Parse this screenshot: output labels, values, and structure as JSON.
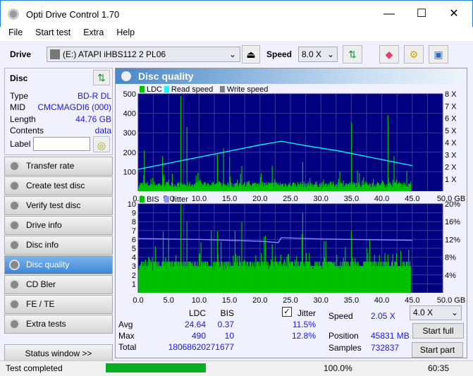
{
  "window": {
    "title": "Opti Drive Control 1.70",
    "minimize": "—",
    "maximize": "☐",
    "close": "✕"
  },
  "menu": [
    "File",
    "Start test",
    "Extra",
    "Help"
  ],
  "toolbar": {
    "drive_label": "Drive",
    "drive_value": "(E:)   ATAPI iHBS112   2 PL06",
    "speed_label": "Speed",
    "speed_value": "8.0 X"
  },
  "disc": {
    "title": "Disc",
    "rows": [
      {
        "k": "Type",
        "v": "BD-R DL"
      },
      {
        "k": "MID",
        "v": "CMCMAGDI6 (000)"
      },
      {
        "k": "Length",
        "v": "44.76 GB"
      },
      {
        "k": "Contents",
        "v": "data"
      }
    ],
    "label_label": "Label",
    "label_value": ""
  },
  "nav": [
    "Transfer rate",
    "Create test disc",
    "Verify test disc",
    "Drive info",
    "Disc info",
    "Disc quality",
    "CD Bler",
    "FE / TE",
    "Extra tests"
  ],
  "nav_active": "Disc quality",
  "status_window": "Status window >>",
  "panel_title": "Disc quality",
  "colors": {
    "ldc": "#00c000",
    "read_speed": "#00ffff",
    "write_speed": "#808080",
    "bis": "#00c000",
    "jitter": "#9090ff",
    "plot_bg": "#000080",
    "progress": "#06b025"
  },
  "chart_data": [
    {
      "type": "bar",
      "legend": [
        "LDC",
        "Read speed",
        "Write speed"
      ],
      "x_ticks": [
        "0.0",
        "5.0",
        "10.0",
        "15.0",
        "20.0",
        "25.0",
        "30.0",
        "35.0",
        "40.0",
        "45.0",
        "50.0 GB"
      ],
      "xlim": [
        0,
        50
      ],
      "y_ticks": [
        "100",
        "200",
        "300",
        "400",
        "500"
      ],
      "ylim": [
        0,
        500
      ],
      "y2_ticks": [
        "1 X",
        "2 X",
        "3 X",
        "4 X",
        "5 X",
        "6 X",
        "7 X",
        "8 X"
      ],
      "y2lim": [
        0,
        8
      ],
      "ldc_spikes": [
        [
          1,
          210
        ],
        [
          4,
          180
        ],
        [
          7,
          490
        ],
        [
          8,
          330
        ],
        [
          13,
          190
        ],
        [
          14,
          220
        ],
        [
          15,
          175
        ],
        [
          17,
          130
        ],
        [
          22,
          130
        ],
        [
          27,
          150
        ],
        [
          35,
          355
        ],
        [
          41,
          390
        ],
        [
          42,
          180
        ]
      ],
      "read_speed": [
        [
          0,
          1.8
        ],
        [
          5,
          2.3
        ],
        [
          10,
          2.8
        ],
        [
          15,
          3.3
        ],
        [
          20,
          3.8
        ],
        [
          23.5,
          4.1
        ],
        [
          28,
          3.7
        ],
        [
          33,
          3.3
        ],
        [
          38,
          2.8
        ],
        [
          42,
          2.4
        ],
        [
          45,
          2.1
        ]
      ]
    },
    {
      "type": "bar",
      "legend": [
        "BIS",
        "Jitter"
      ],
      "x_ticks": [
        "0.0",
        "5.0",
        "10.0",
        "15.0",
        "20.0",
        "25.0",
        "30.0",
        "35.0",
        "40.0",
        "45.0",
        "50.0 GB"
      ],
      "xlim": [
        0,
        50
      ],
      "y_ticks": [
        "1",
        "2",
        "3",
        "4",
        "5",
        "6",
        "7",
        "8",
        "9",
        "10"
      ],
      "ylim": [
        0,
        10
      ],
      "y2_ticks": [
        "4%",
        "8%",
        "12%",
        "16%",
        "20%"
      ],
      "y2lim": [
        0,
        20
      ],
      "bis_spikes": [
        [
          7,
          10
        ],
        [
          8,
          8
        ],
        [
          12,
          7
        ],
        [
          17,
          8
        ],
        [
          22,
          7
        ],
        [
          27,
          9
        ],
        [
          35,
          7
        ],
        [
          38,
          6
        ]
      ],
      "jitter": [
        [
          0,
          12.2
        ],
        [
          10,
          12.0
        ],
        [
          20,
          11.6
        ],
        [
          23,
          11.3
        ],
        [
          23.5,
          12.4
        ],
        [
          30,
          12.1
        ],
        [
          40,
          11.9
        ],
        [
          45,
          11.8
        ]
      ]
    }
  ],
  "stats": {
    "col_ldc": "LDC",
    "col_bis": "BIS",
    "jitter_label": "Jitter",
    "jitter_checked": true,
    "rows": [
      {
        "k": "Avg",
        "ldc": "24.64",
        "bis": "0.37",
        "jit": "11.5%"
      },
      {
        "k": "Max",
        "ldc": "490",
        "bis": "10",
        "jit": "12.8%"
      },
      {
        "k": "Total",
        "ldc": "18068620",
        "bis": "271677",
        "jit": ""
      }
    ],
    "speed_label": "Speed",
    "speed_value": "2.05 X",
    "position_label": "Position",
    "position_value": "45831 MB",
    "samples_label": "Samples",
    "samples_value": "732837",
    "speed_select": "4.0 X",
    "start_full": "Start full",
    "start_part": "Start part"
  },
  "status": {
    "text": "Test completed",
    "progress": 100,
    "progress_text": "100.0%",
    "time": "60:35"
  }
}
